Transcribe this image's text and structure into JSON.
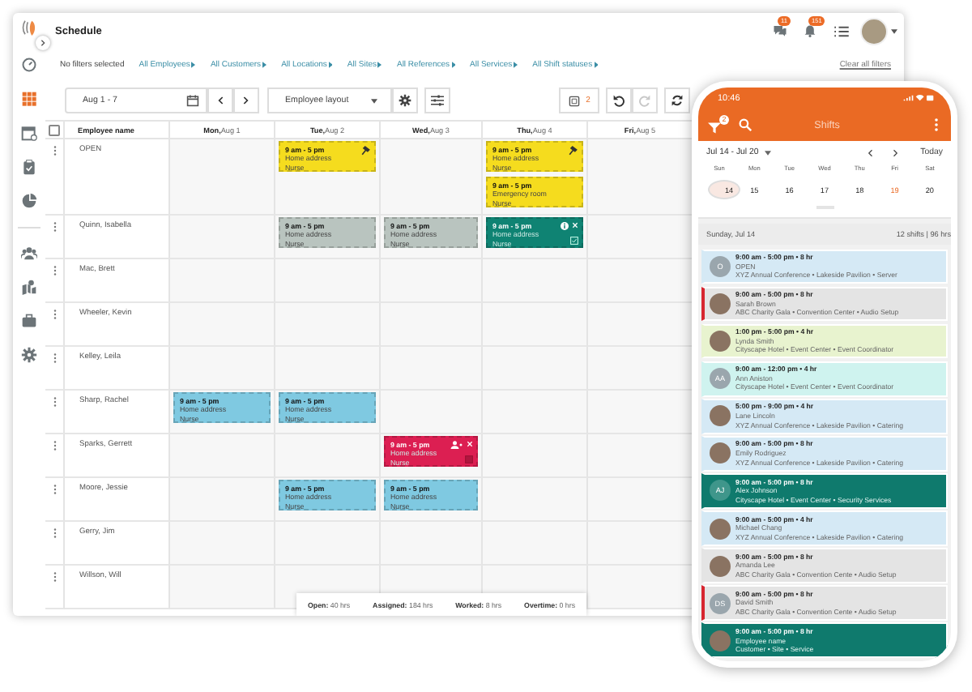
{
  "app": {
    "title": "Schedule"
  },
  "nav": [
    {
      "kind": "dashboard",
      "selected": false
    },
    {
      "kind": "grid",
      "selected": true
    },
    {
      "kind": "calendar",
      "selected": false
    },
    {
      "kind": "clipboard",
      "selected": false
    },
    {
      "kind": "pie",
      "selected": false
    },
    {
      "kind": "people",
      "selected": false
    },
    {
      "kind": "map-person",
      "selected": false
    },
    {
      "kind": "briefcase",
      "selected": false
    },
    {
      "kind": "settings",
      "selected": false
    }
  ],
  "header": {
    "chat_badge": "11",
    "bell_badge": "151"
  },
  "filters": {
    "summary": "No filters selected",
    "links": [
      "All Employees",
      "All Customers",
      "All Locations",
      "All Sites",
      "All References",
      "All Services",
      "All Shift statuses"
    ],
    "clear": "Clear all filters"
  },
  "toolbar": {
    "date_range": "Aug 1 - 7",
    "layout": "Employee layout",
    "publish_count": "2",
    "redo_disabled": true
  },
  "grid": {
    "name_column": "Employee name",
    "select_all_checked": false,
    "days": [
      {
        "weekday": "Mon,",
        "date": "Aug 1"
      },
      {
        "weekday": "Tue,",
        "date": "Aug 2"
      },
      {
        "weekday": "Wed,",
        "date": "Aug 3"
      },
      {
        "weekday": "Thu,",
        "date": "Aug 4"
      },
      {
        "weekday": "Fri,",
        "date": "Aug 5"
      }
    ],
    "rows": [
      {
        "name": "OPEN",
        "cells": [
          [],
          [
            {
              "kind": "open",
              "color": "#f5dc1e",
              "time": "9 am - 5 pm",
              "location": "Home address",
              "role": "Nurse"
            }
          ],
          [],
          [
            {
              "kind": "open",
              "color": "#f5dc1e",
              "time": "9 am - 5 pm",
              "location": "Home address",
              "role": "Nurse"
            },
            {
              "kind": "plain",
              "color": "#f5dc1e",
              "time": "9 am - 5 pm",
              "location": "Emergency room",
              "role": "Nurse"
            }
          ],
          []
        ]
      },
      {
        "name": "Quinn, Isabella",
        "cells": [
          [],
          [
            {
              "kind": "plain",
              "color": "#b9c4bf",
              "time": "9 am - 5 pm",
              "location": "Home address",
              "role": "Nurse"
            }
          ],
          [
            {
              "kind": "plain",
              "color": "#b9c4bf",
              "time": "9 am - 5 pm",
              "location": "Home address",
              "role": "Nurse"
            }
          ],
          [
            {
              "kind": "published",
              "color": "#0f8373",
              "time": "9 am - 5 pm",
              "location": "Home address",
              "role": "Nurse"
            }
          ],
          []
        ]
      },
      {
        "name": "Mac, Brett",
        "cells": [
          [],
          [],
          [],
          [],
          []
        ]
      },
      {
        "name": "Wheeler, Kevin",
        "cells": [
          [],
          [],
          [],
          [],
          []
        ]
      },
      {
        "name": "Kelley, Leila",
        "cells": [
          [],
          [],
          [],
          [],
          []
        ]
      },
      {
        "name": "Sharp, Rachel",
        "cells": [
          [
            {
              "kind": "plain",
              "color": "#7fc9e1",
              "time": "9 am - 5 pm",
              "location": "Home address",
              "role": "Nurse"
            }
          ],
          [
            {
              "kind": "plain",
              "color": "#7fc9e1",
              "time": "9 am - 5 pm",
              "location": "Home address",
              "role": "Nurse"
            }
          ],
          [],
          [],
          []
        ]
      },
      {
        "name": "Sparks, Gerrett",
        "cells": [
          [],
          [],
          [
            {
              "kind": "conflict",
              "color": "#dc1f52",
              "time": "9 am - 5 pm",
              "location": "Home address",
              "role": "Nurse"
            }
          ],
          [],
          []
        ]
      },
      {
        "name": "Moore, Jessie",
        "cells": [
          [],
          [
            {
              "kind": "plain",
              "color": "#7fc9e1",
              "time": "9 am - 5 pm",
              "location": "Home address",
              "role": "Nurse"
            }
          ],
          [
            {
              "kind": "plain",
              "color": "#7fc9e1",
              "time": "9 am - 5 pm",
              "location": "Home address",
              "role": "Nurse"
            }
          ],
          [],
          []
        ]
      },
      {
        "name": "Gerry, Jim",
        "cells": [
          [],
          [],
          [],
          [],
          []
        ]
      },
      {
        "name": "Willson, Will",
        "cells": [
          [],
          [],
          [],
          [],
          []
        ]
      }
    ]
  },
  "totals": [
    {
      "label": "Open:",
      "value": "40 hrs"
    },
    {
      "label": "Assigned:",
      "value": "184 hrs"
    },
    {
      "label": "Worked:",
      "value": "8 hrs"
    },
    {
      "label": "Overtime:",
      "value": "0 hrs"
    }
  ],
  "phone": {
    "time": "10:46",
    "title": "Shifts",
    "filter_badge": "2",
    "range": "Jul 14 - Jul 20",
    "today": "Today",
    "days": [
      {
        "weekday": "Sun",
        "date": "14",
        "selected": true,
        "today": false
      },
      {
        "weekday": "Mon",
        "date": "15",
        "selected": false,
        "today": false
      },
      {
        "weekday": "Tue",
        "date": "16",
        "selected": false,
        "today": false
      },
      {
        "weekday": "Wed",
        "date": "17",
        "selected": false,
        "today": false
      },
      {
        "weekday": "Thu",
        "date": "18",
        "selected": false,
        "today": false
      },
      {
        "weekday": "Fri",
        "date": "19",
        "selected": false,
        "today": true
      },
      {
        "weekday": "Sat",
        "date": "20",
        "selected": false,
        "today": false
      }
    ],
    "day_title": "Sunday, Jul 14",
    "day_summary": "12 shifts | 96 hrs",
    "shifts": [
      {
        "time": "9:00 am - 5:00 pm • 8 hr",
        "name": "OPEN",
        "details": "XYZ Annual Conference • Lakeside Pavilion • Server",
        "color": "#d5e9f5",
        "alert": false,
        "initials": "O"
      },
      {
        "time": "9:00 am - 5:00 pm • 8 hr",
        "name": "Sarah Brown",
        "details": "ABC Charity Gala • Convention Center • Audio Setup",
        "color": "#e4e4e4",
        "alert": true
      },
      {
        "time": "1:00 pm - 5:00 pm • 4 hr",
        "name": "Lynda Smith",
        "details": "Cityscape Hotel • Event Center • Event Coordinator",
        "color": "#e8f3cf",
        "alert": false
      },
      {
        "time": "9:00 am - 12:00 pm • 4 hr",
        "name": "Ann Aniston",
        "details": "Cityscape Hotel • Event Center • Event Coordinator",
        "color": "#cff3ef",
        "alert": false,
        "initials": "AA"
      },
      {
        "time": "5:00 pm - 9:00 pm • 4 hr",
        "name": "Lane Lincoln",
        "details": "XYZ Annual Conference • Lakeside Pavilion • Catering",
        "color": "#d5e9f5",
        "alert": false
      },
      {
        "time": "9:00 am - 5:00 pm • 8 hr",
        "name": "Emily Rodriguez",
        "details": "XYZ Annual Conference • Lakeside Pavilion • Catering",
        "color": "#d5e9f5",
        "alert": false
      },
      {
        "time": "9:00 am - 5:00 pm • 8 hr",
        "name": "Alex Johnson",
        "details": "Cityscape Hotel • Event Center • Security Services",
        "color": "#0f7a6d",
        "alert": false,
        "initials": "AJ"
      },
      {
        "time": "9:00 am - 5:00 pm • 4 hr",
        "name": "Michael Chang",
        "details": "XYZ Annual Conference • Lakeside Pavilion • Catering",
        "color": "#d5e9f5",
        "alert": false
      },
      {
        "time": "9:00 am - 5:00 pm • 8 hr",
        "name": "Amanda Lee",
        "details": "ABC Charity Gala • Convention Cente • Audio Setup",
        "color": "#e4e4e4",
        "alert": false
      },
      {
        "time": "9:00 am - 5:00 pm • 8 hr",
        "name": "David Smith",
        "details": "ABC Charity Gala • Convention Cente • Audio Setup",
        "color": "#e4e4e4",
        "alert": true,
        "initials": "DS"
      },
      {
        "time": "9:00 am - 5:00 pm • 8 hr",
        "name": "Employee name",
        "details": "Customer • Site • Service",
        "color": "#0f7a6d",
        "alert": false
      }
    ]
  }
}
